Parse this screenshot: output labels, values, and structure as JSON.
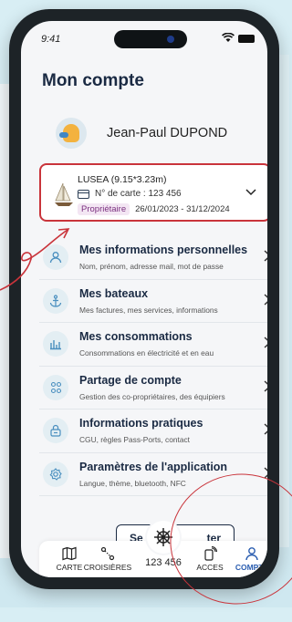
{
  "status": {
    "time": "9:41"
  },
  "page": {
    "title": "Mon compte"
  },
  "user": {
    "name": "Jean-Paul DUPOND"
  },
  "boat": {
    "name": "LUSEA (9.15*3.23m)",
    "card_label": "N° de carte : 123 456",
    "role": "Propriétaire",
    "dates": "26/01/2023 - 31/12/2024"
  },
  "menu": [
    {
      "title": "Mes informations personnelles",
      "subtitle": "Nom, prénom, adresse mail, mot de passe",
      "icon": "person-icon"
    },
    {
      "title": "Mes bateaux",
      "subtitle": "Mes factures, mes services, informations",
      "icon": "anchor-icon"
    },
    {
      "title": "Mes consommations",
      "subtitle": "Consommations en électricité et en eau",
      "icon": "bar-chart-icon"
    },
    {
      "title": "Partage de compte",
      "subtitle": "Gestion des co-propriétaires, des équipiers",
      "icon": "share-users-icon"
    },
    {
      "title": "Informations pratiques",
      "subtitle": "CGU, règles Pass-Ports, contact",
      "icon": "lock-icon"
    },
    {
      "title": "Paramètres de l'application",
      "subtitle": "Langue, thème, bluetooth, NFC",
      "icon": "settings-icon"
    }
  ],
  "logout": {
    "left": "Se",
    "right": "ter"
  },
  "tabbar": {
    "items": [
      {
        "label": "CARTE",
        "icon": "map-icon"
      },
      {
        "label": "CROISIÈRES",
        "icon": "route-icon"
      },
      {
        "label": "ACCES",
        "icon": "nfc-icon"
      },
      {
        "label": "COMPTE",
        "icon": "person-icon"
      }
    ],
    "center_value": "123 456"
  },
  "colors": {
    "accent": "#2a5db0",
    "dark": "#1a2a43",
    "highlight": "#c9343b"
  }
}
